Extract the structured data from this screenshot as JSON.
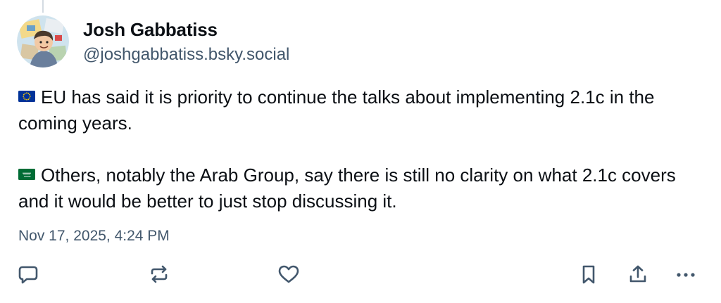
{
  "post": {
    "author": {
      "display_name": "Josh Gabbatiss",
      "handle": "@joshgabbatiss.bsky.social",
      "avatar_icon": "cartoon-portrait-avatar"
    },
    "paragraphs": [
      {
        "flag_icon": "eu-flag-icon",
        "text": "EU has said it is priority to continue the talks about implementing 2.1c in the coming years."
      },
      {
        "flag_icon": "saudi-arabia-flag-icon",
        "text": "Others, notably the Arab Group, say there is still no clarity on what 2.1c covers and it would be better to just stop discussing it."
      }
    ],
    "timestamp": "Nov 17, 2025, 4:24 PM"
  },
  "actions": [
    {
      "name": "reply",
      "icon": "comment-bubble-icon"
    },
    {
      "name": "repost",
      "icon": "repost-arrows-icon"
    },
    {
      "name": "like",
      "icon": "heart-icon"
    },
    {
      "name": "bookmark",
      "icon": "bookmark-icon"
    },
    {
      "name": "share",
      "icon": "share-icon"
    },
    {
      "name": "more",
      "icon": "ellipsis-icon"
    }
  ],
  "colors": {
    "text_primary": "#0b0f14",
    "text_secondary": "#42576c",
    "icon": "#42576c",
    "eu_blue": "#003399",
    "eu_star": "#ffcc00",
    "saudi_green": "#006c35"
  }
}
